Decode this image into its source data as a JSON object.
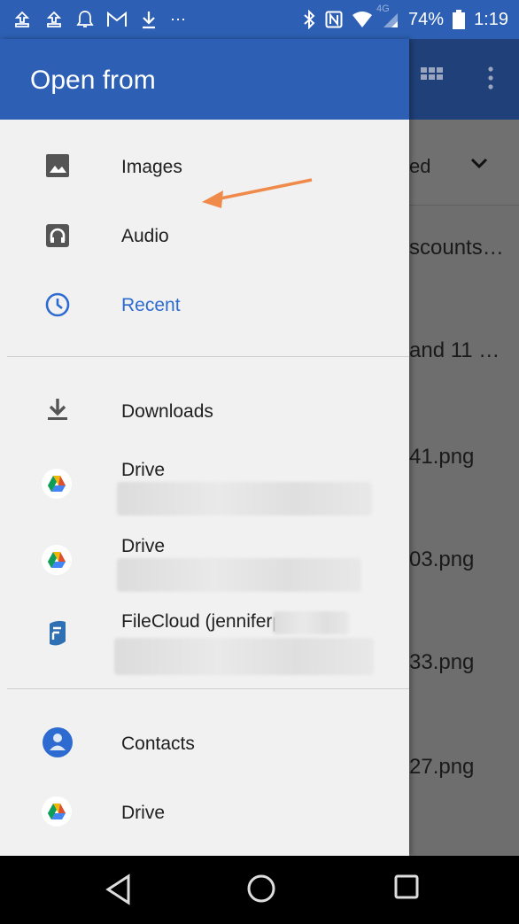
{
  "status_bar": {
    "battery": "74%",
    "time": "1:19",
    "network": "4G"
  },
  "drawer": {
    "title": "Open from",
    "groups": [
      [
        {
          "label": "Images",
          "icon": "image-icon"
        },
        {
          "label": "Audio",
          "icon": "headphones-icon"
        },
        {
          "label": "Recent",
          "icon": "clock-icon",
          "selected": true
        }
      ],
      [
        {
          "label": "Downloads",
          "icon": "download-icon"
        },
        {
          "label": "Drive",
          "icon": "google-drive-icon"
        },
        {
          "label": "Drive",
          "icon": "google-drive-icon"
        },
        {
          "label": "FileCloud (jenniferp",
          "icon": "filecloud-icon"
        }
      ],
      [
        {
          "label": "Contacts",
          "icon": "contacts-icon"
        },
        {
          "label": "Drive",
          "icon": "google-drive-icon"
        }
      ]
    ]
  },
  "background_app": {
    "sort_label": "ed",
    "files": [
      "scounts…",
      "and 11 …",
      "41.png",
      "03.png",
      "33.png",
      "27.png"
    ]
  },
  "colors": {
    "accent": "#2d60b4",
    "selected_text": "#2d6bd1",
    "annotation_arrow": "#f08a4b"
  }
}
